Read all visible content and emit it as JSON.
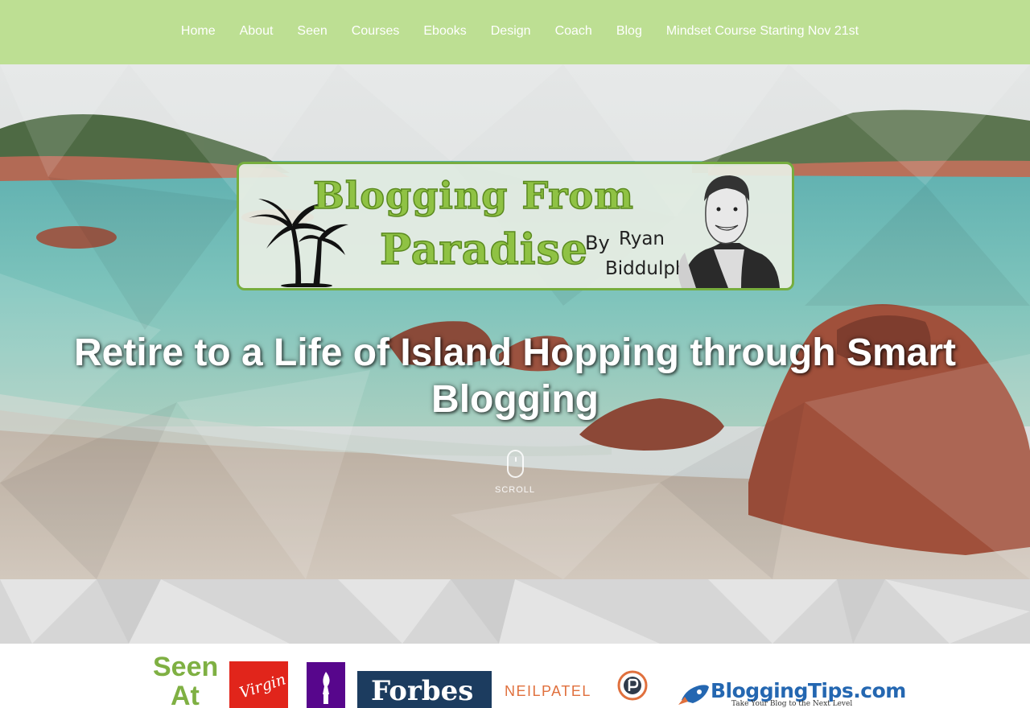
{
  "nav": {
    "items": [
      "Home",
      "About",
      "Seen",
      "Courses",
      "Ebooks",
      "Design",
      "Coach",
      "Blog",
      "Mindset Course Starting Nov 21st"
    ]
  },
  "hero": {
    "logo": {
      "line1": "Blogging From",
      "line2": "Paradise",
      "by": "By",
      "name1": "Ryan",
      "name2": "Biddulph"
    },
    "headline": "Retire to a Life of Island Hopping through Smart Blogging",
    "scroll_label": "SCROLL"
  },
  "seen_at": {
    "word1": "Seen",
    "word2": "At",
    "logos": {
      "virgin": "Virgin",
      "forbes": "Forbes",
      "neilpatel": "NEILPATEL",
      "bloggingtips": "BloggingTips.com",
      "bloggingtips_sub": "Take Your Blog to the Next Level"
    }
  },
  "colors": {
    "nav_bg": "#bddf93",
    "accent_green": "#7fb043",
    "forbes_blue": "#1c3c5f",
    "virgin_red": "#e1251b",
    "nyu_purple": "#57068c"
  }
}
